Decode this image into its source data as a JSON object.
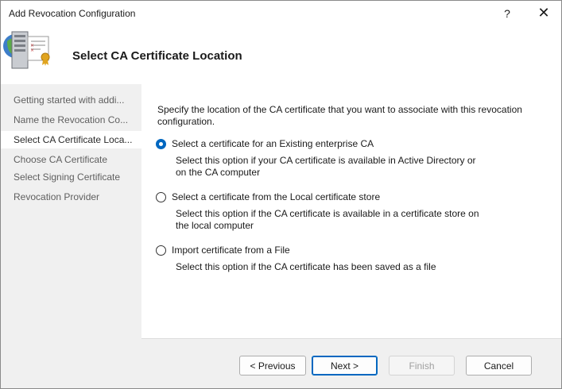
{
  "window": {
    "title": "Add Revocation Configuration",
    "help_glyph": "?",
    "close_glyph": "✕"
  },
  "header": {
    "icon": "server-certificate-icon",
    "title": "Select CA Certificate Location"
  },
  "sidebar": {
    "items": [
      {
        "label": "Getting started with addi...",
        "active": false
      },
      {
        "label": "Name the Revocation Co...",
        "active": false
      },
      {
        "label": "Select CA Certificate Loca...",
        "active": true
      },
      {
        "label": "Choose CA Certificate",
        "active": false
      },
      {
        "label": "Select Signing Certificate",
        "active": false
      },
      {
        "label": "Revocation Provider",
        "active": false
      }
    ]
  },
  "main": {
    "description": "Specify the location of the CA certificate that you want to associate with this revocation configuration.",
    "options": [
      {
        "label": "Select a certificate for an Existing enterprise CA",
        "description_lines": [
          "Select this option if your CA certificate is available in Active Directory or",
          "on the CA computer"
        ],
        "checked": true
      },
      {
        "label": "Select a certificate from the Local certificate store",
        "description_lines": [
          "Select this option if the CA certificate is available in a certificate store on",
          "the local computer"
        ],
        "checked": false
      },
      {
        "label": "Import certificate from a File",
        "description_lines": [
          "Select this option if the CA certificate has been saved as a file"
        ],
        "checked": false
      }
    ]
  },
  "footer": {
    "previous_label": "< Previous",
    "next_label": "Next >",
    "finish_label": "Finish",
    "cancel_label": "Cancel"
  },
  "colors": {
    "accent": "#0067c0",
    "window_bg": "#f0f0f0",
    "panel_bg": "#ffffff"
  }
}
